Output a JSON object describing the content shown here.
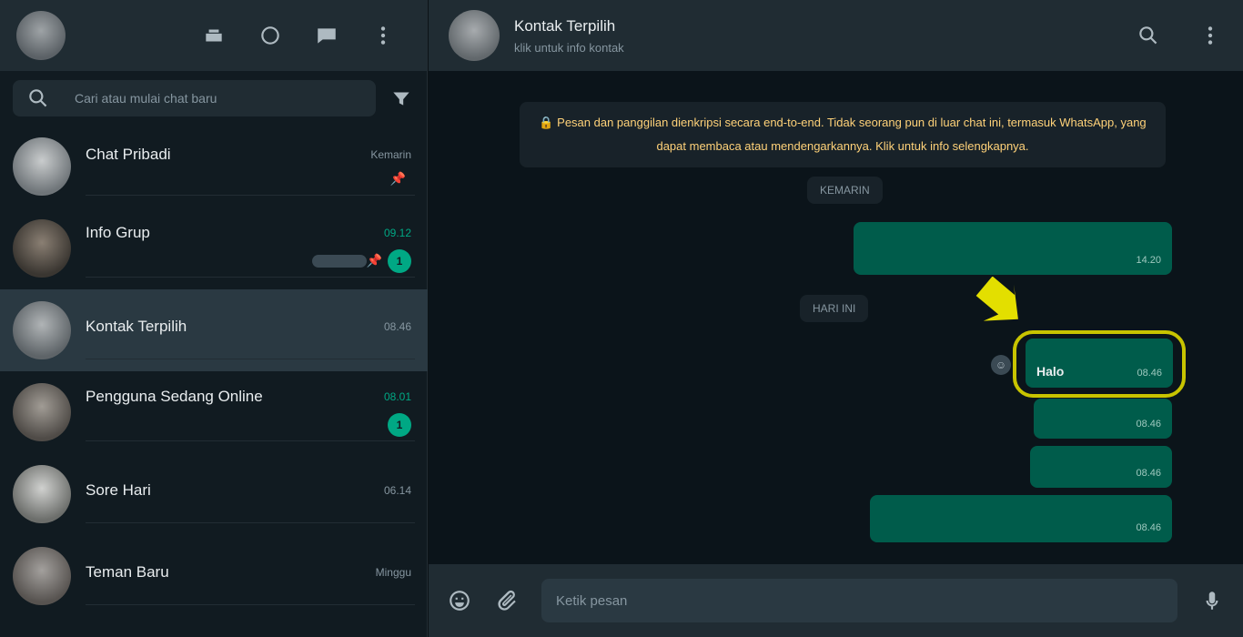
{
  "left_header": {
    "icons": [
      "communities-icon",
      "status-icon",
      "new-chat-icon",
      "menu-icon"
    ]
  },
  "search": {
    "placeholder": "Cari atau mulai chat baru"
  },
  "chats": [
    {
      "name": "Chat Pribadi",
      "last": "",
      "time": "Kemarin",
      "pinned": true,
      "unread": "",
      "avatar": "#8e9498"
    },
    {
      "name": "Info Grup",
      "last": "",
      "time": "09.12",
      "pinned": true,
      "unread": "1",
      "avatar": "#6b625a"
    },
    {
      "name": "Kontak Terpilih",
      "last": "",
      "time": "08.46",
      "pinned": false,
      "unread": "",
      "avatar": "#878c90",
      "active": true
    },
    {
      "name": "Pengguna Sedang Online",
      "last": "",
      "time": "08.01",
      "pinned": false,
      "unread": "1",
      "avatar": "#77736e"
    },
    {
      "name": "Sore Hari",
      "last": "",
      "time": "06.14",
      "pinned": false,
      "unread": "",
      "avatar": "#9b9c9a"
    },
    {
      "name": "Teman Baru",
      "last": "",
      "time": "Minggu",
      "pinned": false,
      "unread": "",
      "avatar": "#7d7a78"
    }
  ],
  "contact": {
    "name": "Kontak Terpilih",
    "subtitle": "klik untuk info kontak"
  },
  "conversation": {
    "encryption_notice": "Pesan dan panggilan dienkripsi secara end-to-end. Tidak seorang pun di luar chat ini, termasuk WhatsApp, yang dapat membaca atau mendengarkannya. Klik untuk info selengkapnya.",
    "date_chip_1": "KEMARIN",
    "date_chip_2": "HARI INI",
    "messages": [
      {
        "text": "",
        "time": "14.20"
      },
      {
        "text": "Halo",
        "time": "08.46"
      },
      {
        "text": "",
        "time": "08.46"
      },
      {
        "text": "",
        "time": "08.46"
      },
      {
        "text": "",
        "time": "08.46"
      }
    ]
  },
  "footer": {
    "placeholder": "Ketik pesan"
  },
  "colors": {
    "accent": "#00a884",
    "outgoing_bubble": "#005c4b",
    "highlight": "#c8c400",
    "notice_text": "#ffd279"
  }
}
